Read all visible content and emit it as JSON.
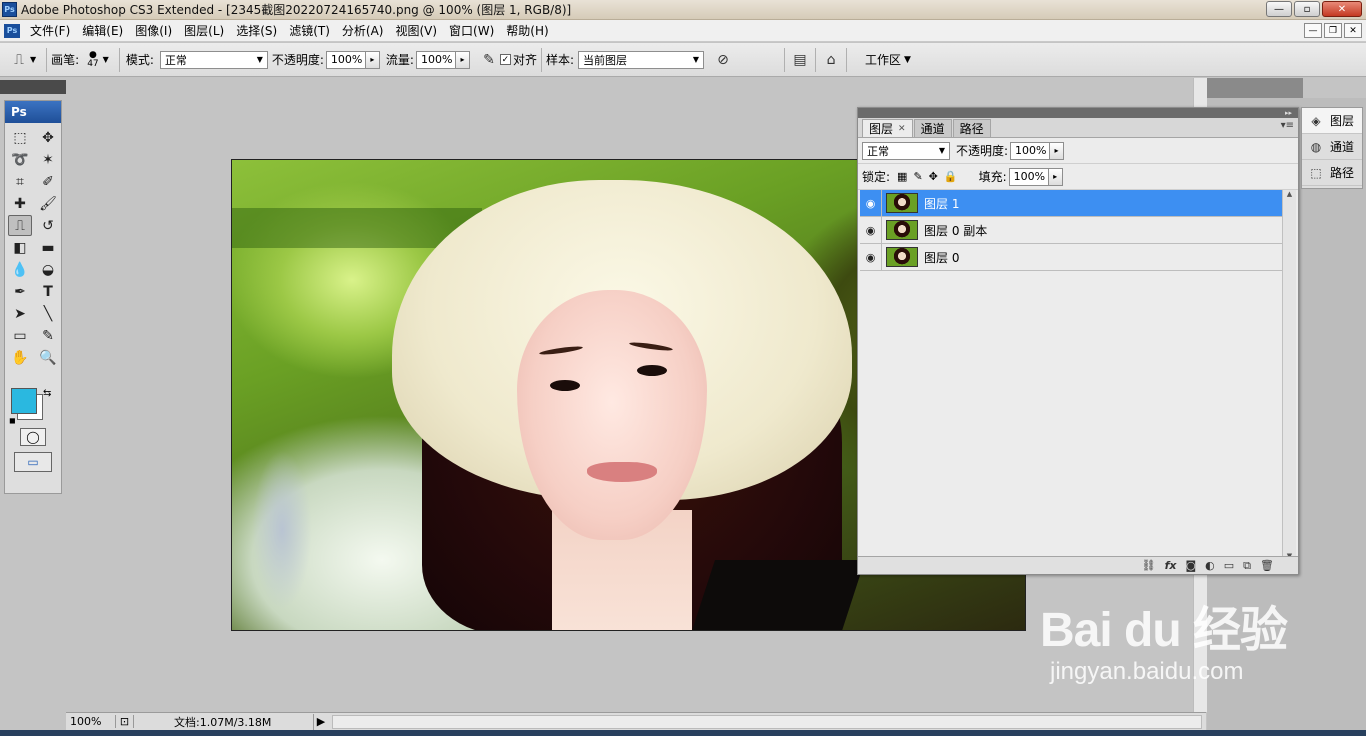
{
  "titlebar": {
    "app_badge": "Ps",
    "title": "Adobe Photoshop CS3 Extended - [2345截图20220724165740.png @ 100% (图层 1, RGB/8)]",
    "minimize": "—",
    "maximize": "▫",
    "close": "✕"
  },
  "menubar": {
    "badge": "Ps",
    "items": [
      "文件(F)",
      "编辑(E)",
      "图像(I)",
      "图层(L)",
      "选择(S)",
      "滤镜(T)",
      "分析(A)",
      "视图(V)",
      "窗口(W)",
      "帮助(H)"
    ]
  },
  "options": {
    "brush_label": "画笔:",
    "brush_size": "47",
    "mode_label": "模式:",
    "mode_value": "正常",
    "opacity_label": "不透明度:",
    "opacity_value": "100%",
    "flow_label": "流量:",
    "flow_value": "100%",
    "align_label": "对齐",
    "align_checked": true,
    "sample_label": "样本:",
    "sample_value": "当前图层",
    "workspace_label": "工作区"
  },
  "toolbox": {
    "title": "Ps",
    "foreground_color": "#2ab8e0",
    "background_color": "#ffffff"
  },
  "layers_panel": {
    "tabs": [
      {
        "label": "图层",
        "active": true
      },
      {
        "label": "通道",
        "active": false
      },
      {
        "label": "路径",
        "active": false
      }
    ],
    "blend_mode": "正常",
    "opacity_label": "不透明度:",
    "opacity_value": "100%",
    "lock_label": "锁定:",
    "fill_label": "填充:",
    "fill_value": "100%",
    "layers": [
      {
        "name": "图层 1",
        "selected": true,
        "visible": true
      },
      {
        "name": "图层 0 副本",
        "selected": false,
        "visible": true
      },
      {
        "name": "图层 0",
        "selected": false,
        "visible": true
      }
    ],
    "selected_color": "#3d8ff2"
  },
  "dock": {
    "items": [
      {
        "label": "图层",
        "icon": "layers-icon"
      },
      {
        "label": "通道",
        "icon": "channels-icon"
      },
      {
        "label": "路径",
        "icon": "paths-icon"
      }
    ]
  },
  "statusbar": {
    "zoom": "100%",
    "doc_info": "文档:1.07M/3.18M"
  },
  "watermark": {
    "main": "Bai du 经验",
    "sub": "jingyan.baidu.com"
  }
}
